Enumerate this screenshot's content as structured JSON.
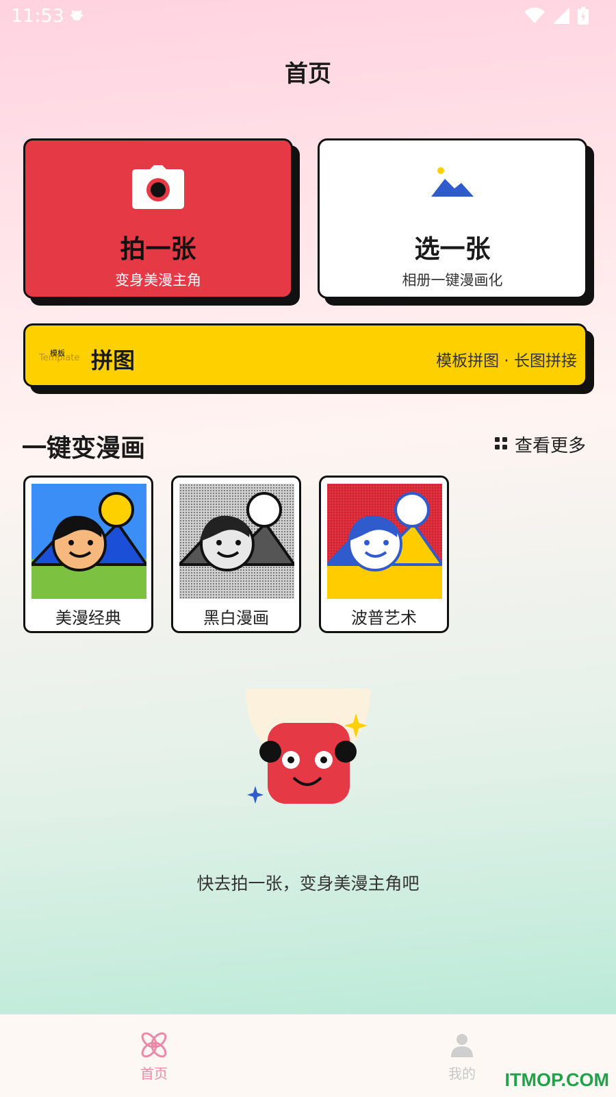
{
  "status_bar": {
    "time": "11:53",
    "icons": [
      "debug-icon",
      "wifi-icon",
      "signal-icon",
      "battery-icon"
    ]
  },
  "page_title": "首页",
  "actions": {
    "photo": {
      "title": "拍一张",
      "subtitle": "变身美漫主角",
      "icon": "camera-icon"
    },
    "album": {
      "title": "选一张",
      "subtitle": "相册一键漫画化",
      "icon": "image-icon"
    }
  },
  "collage": {
    "badge_bg": "Template",
    "badge_fg": "模板",
    "title": "拼图",
    "subtitle": "模板拼图 · 长图拼接"
  },
  "section": {
    "title": "一键变漫画",
    "more_label": "查看更多"
  },
  "styles": [
    {
      "label": "美漫经典"
    },
    {
      "label": "黑白漫画"
    },
    {
      "label": "波普艺术"
    }
  ],
  "empty_state": {
    "text": "快去拍一张，变身美漫主角吧"
  },
  "bottom_nav": [
    {
      "label": "首页",
      "icon": "flower-icon",
      "active": true
    },
    {
      "label": "我的",
      "icon": "user-icon",
      "active": false
    }
  ],
  "watermark": "ITMOP.COM",
  "colors": {
    "red": "#e63946",
    "yellow": "#ffd000",
    "accent_pink": "#ee88aa"
  }
}
